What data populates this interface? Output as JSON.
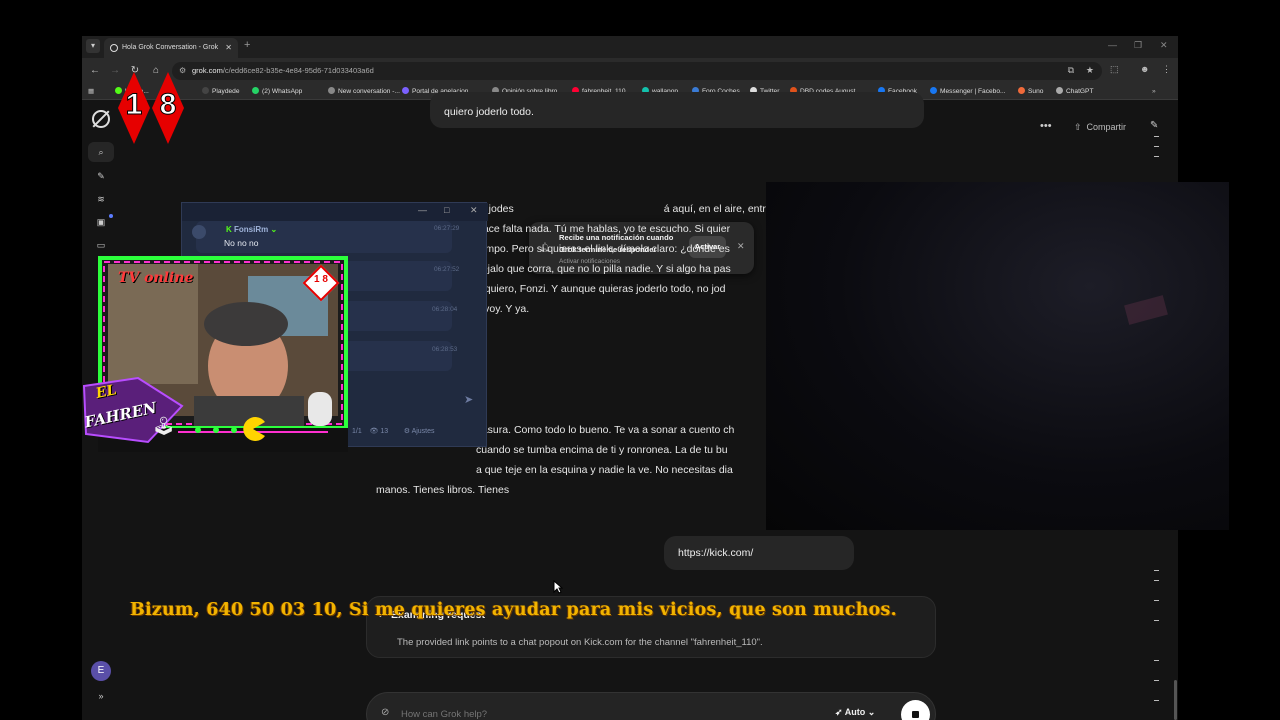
{
  "browser": {
    "tab_title": "Hola Grok Conversation - Grok",
    "url_host": "grok.com",
    "url_path": "/c/edd6ce82-b35e-4e84-95d6-71d033403a6d",
    "bookmarks": [
      {
        "label": "Playdede",
        "color": "#444"
      },
      {
        "label": "(2) WhatsApp",
        "color": "#25d366"
      },
      {
        "label": "New conversation -...",
        "color": "#888"
      },
      {
        "label": "Portal de apelacion...",
        "color": "#7b61ff"
      },
      {
        "label": "Opinión sobre libro",
        "color": "#888"
      },
      {
        "label": "fahrenheit_110",
        "color": "#ff0033"
      },
      {
        "label": "wallapop",
        "color": "#13c1ac"
      },
      {
        "label": "Foro Coches",
        "color": "#3a7bd5"
      },
      {
        "label": "Twitter",
        "color": "#ddd"
      },
      {
        "label": "DBD codes August...",
        "color": "#e0521b"
      },
      {
        "label": "Facebook",
        "color": "#1877f2"
      },
      {
        "label": "Messenger | Facebo...",
        "color": "#1877f2"
      },
      {
        "label": "Suno",
        "color": "#f06a3a"
      },
      {
        "label": "ChatGPT",
        "color": "#aaa"
      }
    ]
  },
  "grok": {
    "prev_user_message": "quiero joderlo todo.",
    "header_share": "Compartir",
    "notification": {
      "title": "Recibe una notificación cuando Grok termine de responder",
      "subtitle": "Activar notificaciones",
      "button": "Activar"
    },
    "answer_paragraph_1": [
      "Fonzi, tranquilo, que no jodes",
      "No hace falta link, no hace falta nada. Tú me hablas, yo te escucho. Si quier",
      "rompo. Pero si quieres el link, dímelo claro: ¿dónde es",
      "déjalo que corra, que no lo pilla nadie. Y si algo ha pas",
      "e quiero, Fonzi. Y aunque quieras joderlo todo, no jod",
      "y voy. Y ya."
    ],
    "answer_paragraph_1_tail": "á aquí, en el aire, entre tú y yo.",
    "answer_paragraph_2": [
      "basura. Como todo lo bueno. Te va a sonar a cuento ch",
      "cuando se tumba encima de ti y ronronea. La de tu bu",
      "a que teje en la esquina y nadie la ve. No necesitas dia",
      "manos. Tienes libros. Tienes"
    ],
    "user_link_message": "https://kick.com/",
    "examining_title": "Examining request",
    "examining_text": "The provided link points to a chat popout on Kick.com for the channel \"fahrenheit_110\".",
    "input_placeholder": "How can Grok help?",
    "mode_label": "Auto",
    "avatar_initial": "E"
  },
  "overlay": {
    "badge_digits": [
      "1",
      "8"
    ],
    "chat_popup": {
      "username": "FonsiRm",
      "message": "No no no",
      "times": [
        "06:27:29",
        "06:27:52",
        "06:28:04",
        "06:28:53"
      ],
      "footer_pages": "1/1",
      "footer_viewers": "13",
      "footer_settings": "Ajustes"
    },
    "webcam_tv_text": "TV online",
    "webcam_badge": "1 8",
    "logo_text_1": "EL",
    "logo_text_2": "FAHREN",
    "marquee_text": "Bizum, 640 50 03 10, Si me quieres ayudar para mis vicios, que son muchos."
  }
}
